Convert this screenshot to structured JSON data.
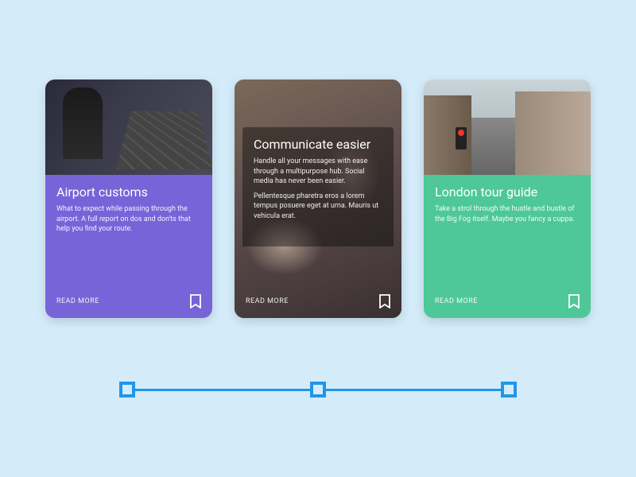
{
  "cards": [
    {
      "title": "Airport customs",
      "description": "What to expect while passing through the airport. A full report on dos and don'ts that help you find your route.",
      "readMore": "READ MORE",
      "accentColor": "#7764d8"
    },
    {
      "title": "Communicate easier",
      "description1": "Handle all your messages with ease through a multipurpose hub. Social media has never been easier.",
      "description2": "Pellentesque pharetra eros a lorem tempus posuere eget at urna. Mauris ut vehicula erat.",
      "readMore": "READ MORE",
      "accentColor": "rgba(0,0,0,0.38)"
    },
    {
      "title": "London tour guide",
      "description": "Take a strol through the hustle and bustle of the Big Fog itself. Maybe you fancy a cuppa.",
      "readMore": "READ MORE",
      "accentColor": "#4ec896"
    }
  ],
  "slider": {
    "trackColor": "#2196e8",
    "handleCount": 3
  }
}
